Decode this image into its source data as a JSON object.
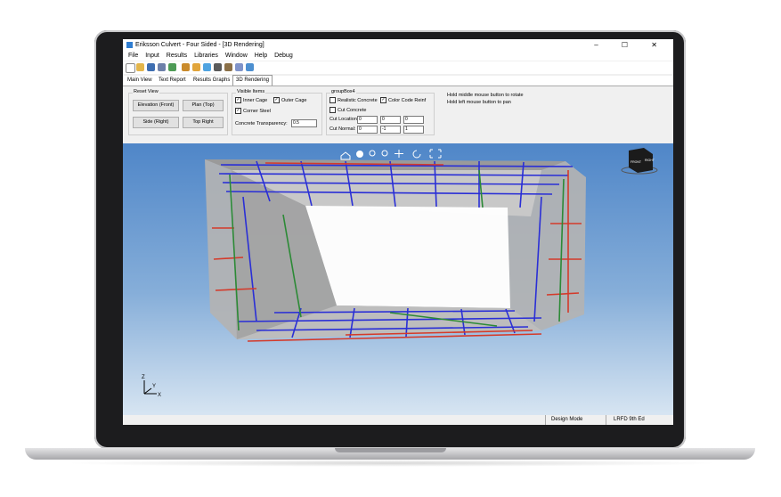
{
  "window": {
    "title": "Eriksson Culvert - Four Sided - [3D Rendering]",
    "controls": "–  ☐  ✕"
  },
  "menu": [
    "File",
    "Input",
    "Results",
    "Libraries",
    "Window",
    "Help",
    "Debug"
  ],
  "tabs": [
    {
      "label": "Main View"
    },
    {
      "label": "Text Report"
    },
    {
      "label": "Results Graphs"
    },
    {
      "label": "3D Rendering",
      "active": true
    }
  ],
  "reset_view": {
    "title": "Reset View",
    "elevation": "Elevation (Front)",
    "plan": "Plan (Top)",
    "side": "Side (Right)",
    "top_right": "Top Right"
  },
  "visible_items": {
    "title": "Visible Items",
    "inner_cage": {
      "label": "Inner Cage",
      "checked": true
    },
    "outer_cage": {
      "label": "Outer Cage",
      "checked": true
    },
    "corner_steel": {
      "label": "Corner Steel",
      "checked": true
    },
    "transparency_label": "Concrete Transparency:",
    "transparency_value": "0.5"
  },
  "groupbox4": {
    "title": "groupBox4",
    "realistic": {
      "label": "Realistic Concrete",
      "checked": false
    },
    "color_code": {
      "label": "Color Code Reinf",
      "checked": true
    },
    "cut_concrete": {
      "label": "Cut Concrete",
      "checked": false
    },
    "cut_location_label": "Cut Location:",
    "cut_location": [
      "0",
      "0",
      "0"
    ],
    "cut_normal_label": "Cut Normal:",
    "cut_normal": [
      "0",
      "-1",
      "1"
    ]
  },
  "hints": [
    "Hold middle mouse button to rotate",
    "Hold left mouse button to pan"
  ],
  "viewcube": {
    "front": "FRONT",
    "right": "RIGHT"
  },
  "axes": {
    "z": "Z",
    "y": "Y",
    "x": "X"
  },
  "status": {
    "mode": "Design Mode",
    "code": "LRFD 9th Ed"
  },
  "colors": {
    "background_top": "#4f86c8",
    "rebar_blue": "#2a2fd6",
    "rebar_red": "#d43a2a",
    "rebar_green": "#2c8a36",
    "concrete": "#a9a9a9"
  }
}
